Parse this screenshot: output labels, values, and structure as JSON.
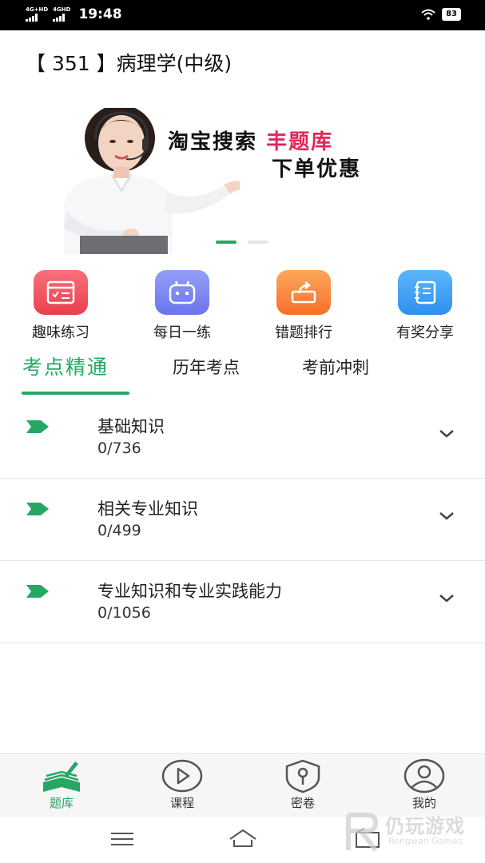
{
  "status_bar": {
    "network1": "4G+HD",
    "network2": "4GHD",
    "time": "19:48",
    "battery": "83"
  },
  "header": {
    "title": "【 351 】病理学(中级)"
  },
  "banner": {
    "line1_text": "淘宝搜索",
    "line1_highlight": "丰题库",
    "line2_text": "下单优惠",
    "slide_count": 2,
    "active_slide": 1
  },
  "quick_actions": [
    {
      "label": "趣味练习",
      "icon": "calendar-check-icon",
      "color": "#f0515a"
    },
    {
      "label": "每日一练",
      "icon": "robot-face-icon",
      "color": "#7b86f2"
    },
    {
      "label": "错题排行",
      "icon": "export-box-icon",
      "color": "#fa8a3a"
    },
    {
      "label": "有奖分享",
      "icon": "notebook-icon",
      "color": "#3a9ff5"
    }
  ],
  "tabs": [
    {
      "label": "考点精通",
      "active": true
    },
    {
      "label": "历年考点",
      "active": false
    },
    {
      "label": "考前冲刺",
      "active": false
    }
  ],
  "sections": [
    {
      "title": "基础知识",
      "progress": "0/736"
    },
    {
      "title": "相关专业知识",
      "progress": "0/499"
    },
    {
      "title": "专业知识和专业实践能力",
      "progress": "0/1056"
    }
  ],
  "bottom_nav": [
    {
      "label": "题库",
      "icon": "question-bank-icon",
      "active": true
    },
    {
      "label": "课程",
      "icon": "play-circle-icon",
      "active": false
    },
    {
      "label": "密卷",
      "icon": "shield-key-icon",
      "active": false
    },
    {
      "label": "我的",
      "icon": "user-circle-icon",
      "active": false
    }
  ],
  "watermark": {
    "main": "仍玩游戏",
    "sub": "Rengwan Games"
  },
  "colors": {
    "accent": "#26a764",
    "highlight": "#e4265a"
  }
}
